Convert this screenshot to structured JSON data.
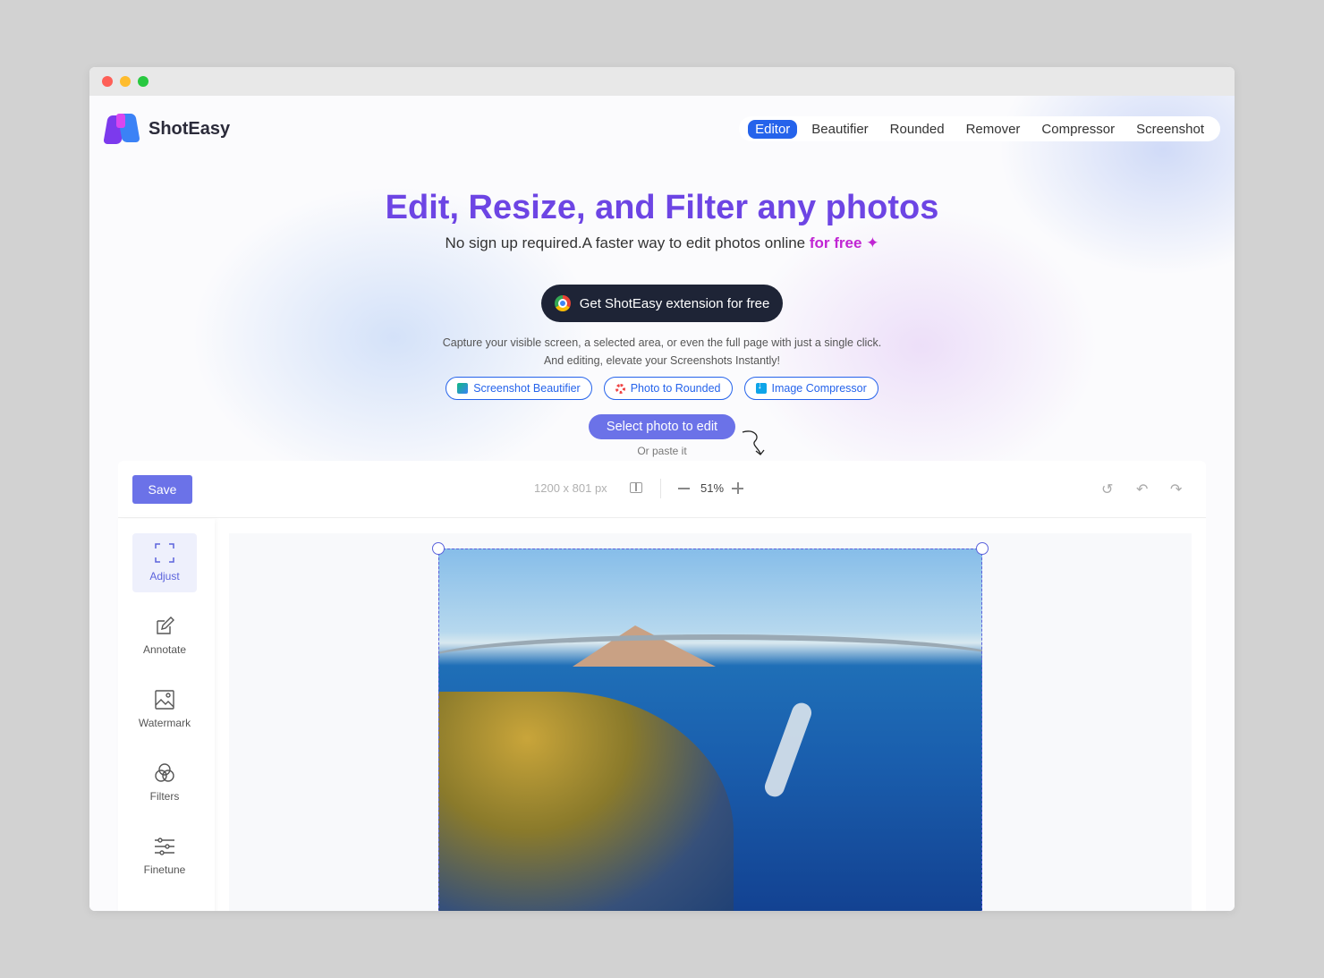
{
  "app": {
    "name": "ShotEasy"
  },
  "nav": {
    "items": [
      {
        "label": "Editor",
        "active": true
      },
      {
        "label": "Beautifier",
        "active": false
      },
      {
        "label": "Rounded",
        "active": false
      },
      {
        "label": "Remover",
        "active": false
      },
      {
        "label": "Compressor",
        "active": false
      },
      {
        "label": "Screenshot",
        "active": false
      }
    ]
  },
  "hero": {
    "title": "Edit, Resize, and Filter any photos",
    "subtitle": "No sign up required.A faster way to edit photos online",
    "subtitle_highlight": "for free",
    "cta_label": "Get ShotEasy extension for free",
    "desc_line1": "Capture your visible screen, a selected area, or even the full page with just a single click.",
    "desc_line2": "And editing, elevate your Screenshots Instantly!",
    "pills": [
      {
        "label": "Screenshot Beautifier",
        "icon": "image-icon"
      },
      {
        "label": "Photo to Rounded",
        "icon": "rounded-icon"
      },
      {
        "label": "Image Compressor",
        "icon": "download-icon"
      }
    ],
    "select_label": "Select photo to edit",
    "paste_hint": "Or paste it"
  },
  "editor": {
    "save_label": "Save",
    "dimensions": "1200 x 801 px",
    "zoom": "51%",
    "tools": [
      {
        "label": "Adjust",
        "icon": "crop-icon",
        "active": true
      },
      {
        "label": "Annotate",
        "icon": "pencil-icon",
        "active": false
      },
      {
        "label": "Watermark",
        "icon": "image-icon",
        "active": false
      },
      {
        "label": "Filters",
        "icon": "filters-icon",
        "active": false
      },
      {
        "label": "Finetune",
        "icon": "sliders-icon",
        "active": false
      }
    ]
  },
  "colors": {
    "accent": "#6b72e8",
    "brand_title": "#6d45e4",
    "nav_active": "#2563eb",
    "highlight": "#c026d3"
  }
}
